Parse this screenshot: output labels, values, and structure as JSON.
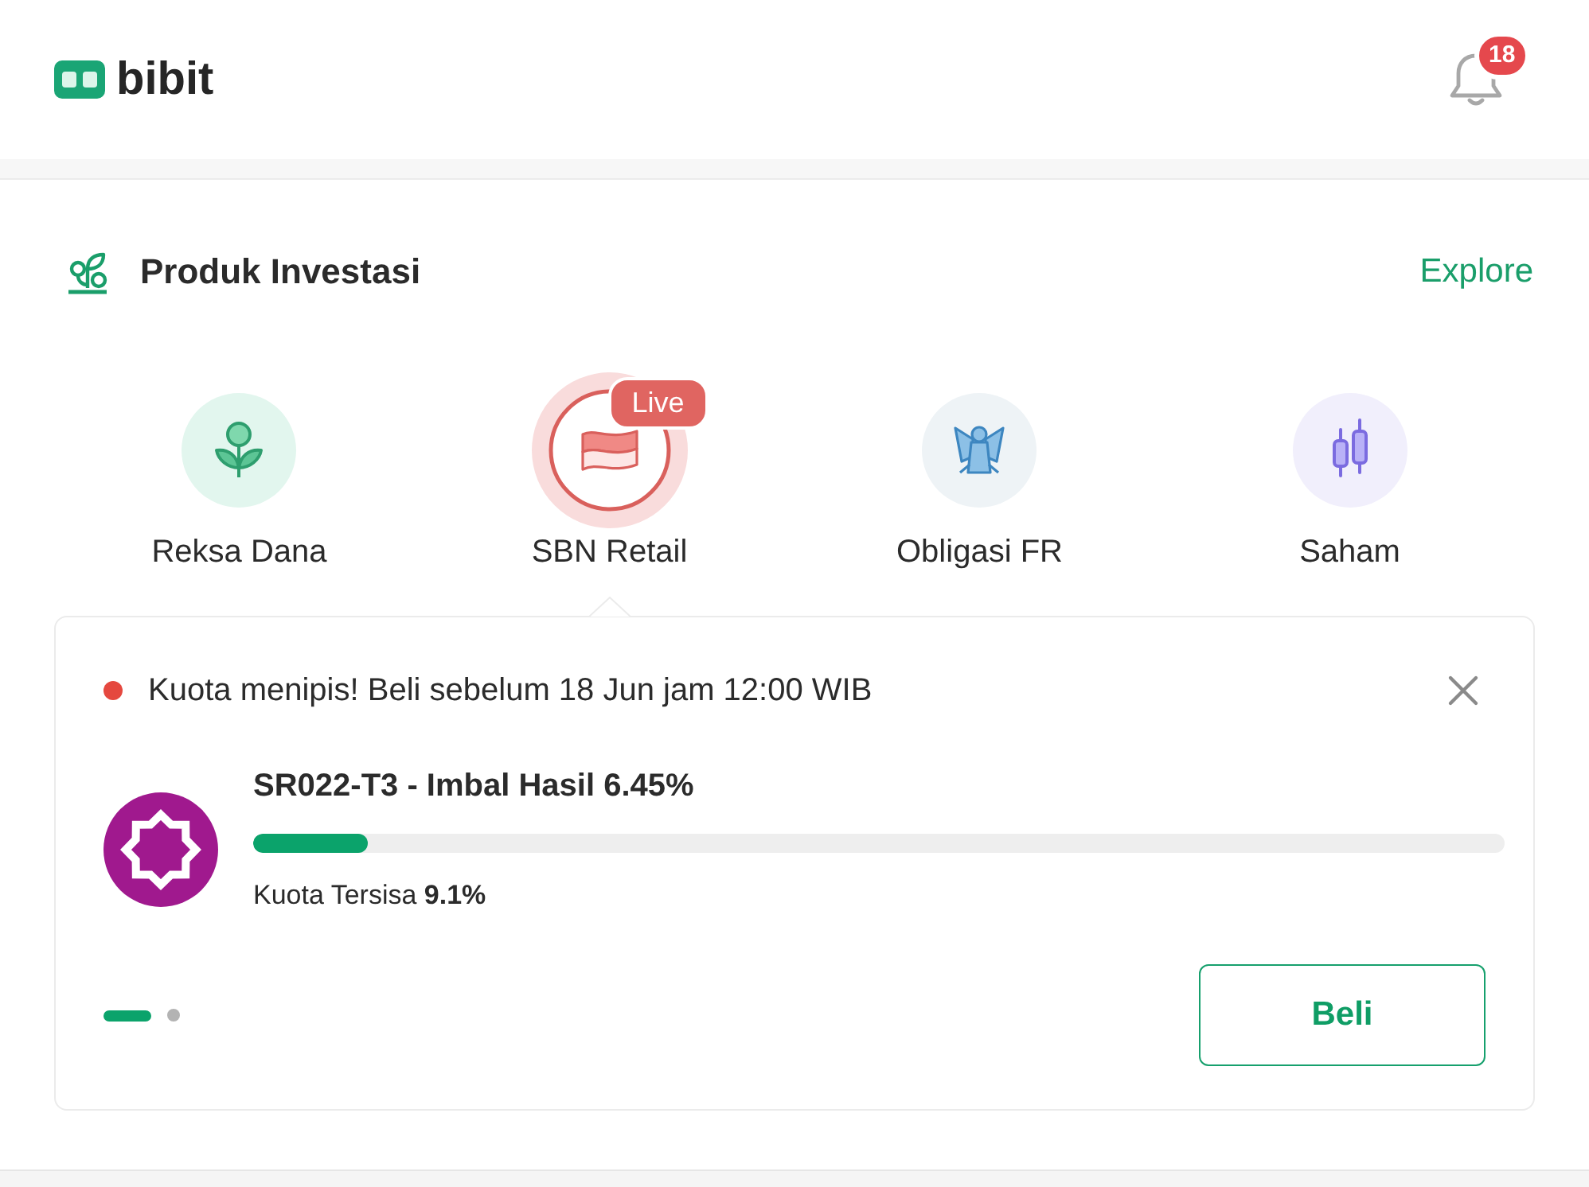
{
  "header": {
    "logo_text": "bibit",
    "notification_count": "18"
  },
  "section": {
    "title": "Produk Investasi",
    "link": "Explore"
  },
  "products": [
    {
      "label": "Reksa Dana",
      "kind": "reksa",
      "selected": false
    },
    {
      "label": "SBN Retail",
      "kind": "sbn",
      "selected": true,
      "badge": "Live"
    },
    {
      "label": "Obligasi FR",
      "kind": "obligasi",
      "selected": false
    },
    {
      "label": "Saham",
      "kind": "saham",
      "selected": false
    }
  ],
  "promo": {
    "alert": "Kuota menipis! Beli sebelum 18 Jun jam 12:00 WIB",
    "title": "SR022-T3 - Imbal Hasil 6.45%",
    "quota_text": "Kuota Tersisa **9.1%**",
    "level": 0.091,
    "button": "Beli"
  },
  "pager": [
    {
      "selected": true
    },
    {
      "selected": false
    }
  ]
}
